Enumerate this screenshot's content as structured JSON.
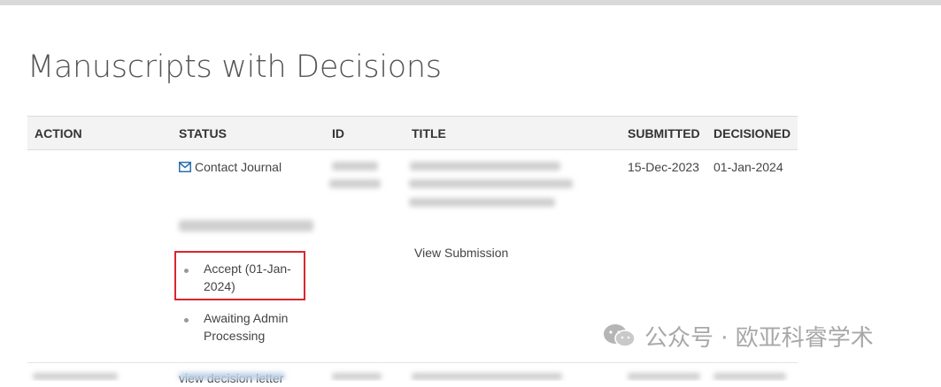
{
  "page": {
    "title": "Manuscripts with Decisions"
  },
  "table": {
    "headers": [
      "ACTION",
      "STATUS",
      "ID",
      "TITLE",
      "SUBMITTED",
      "DECISIONED"
    ],
    "rows": [
      {
        "contact_link": "Contact Journal",
        "status_items": [
          "Accept (01-Jan-2024)",
          "Awaiting Admin Processing"
        ],
        "status_item_1_line1": "Accept (01-Jan-",
        "status_item_1_line2": "2024)",
        "status_item_2_line1": "Awaiting Admin",
        "status_item_2_line2": "Processing",
        "decision_letter_link": "view decision letter",
        "view_submission_link": "View Submission",
        "submitted": "15-Dec-2023",
        "decisioned": "01-Jan-2024"
      }
    ]
  },
  "watermark": {
    "text": "公众号 · 欧亚科睿学术"
  },
  "colors": {
    "link": "#2a6fb0",
    "highlight_box": "#d9262c"
  }
}
